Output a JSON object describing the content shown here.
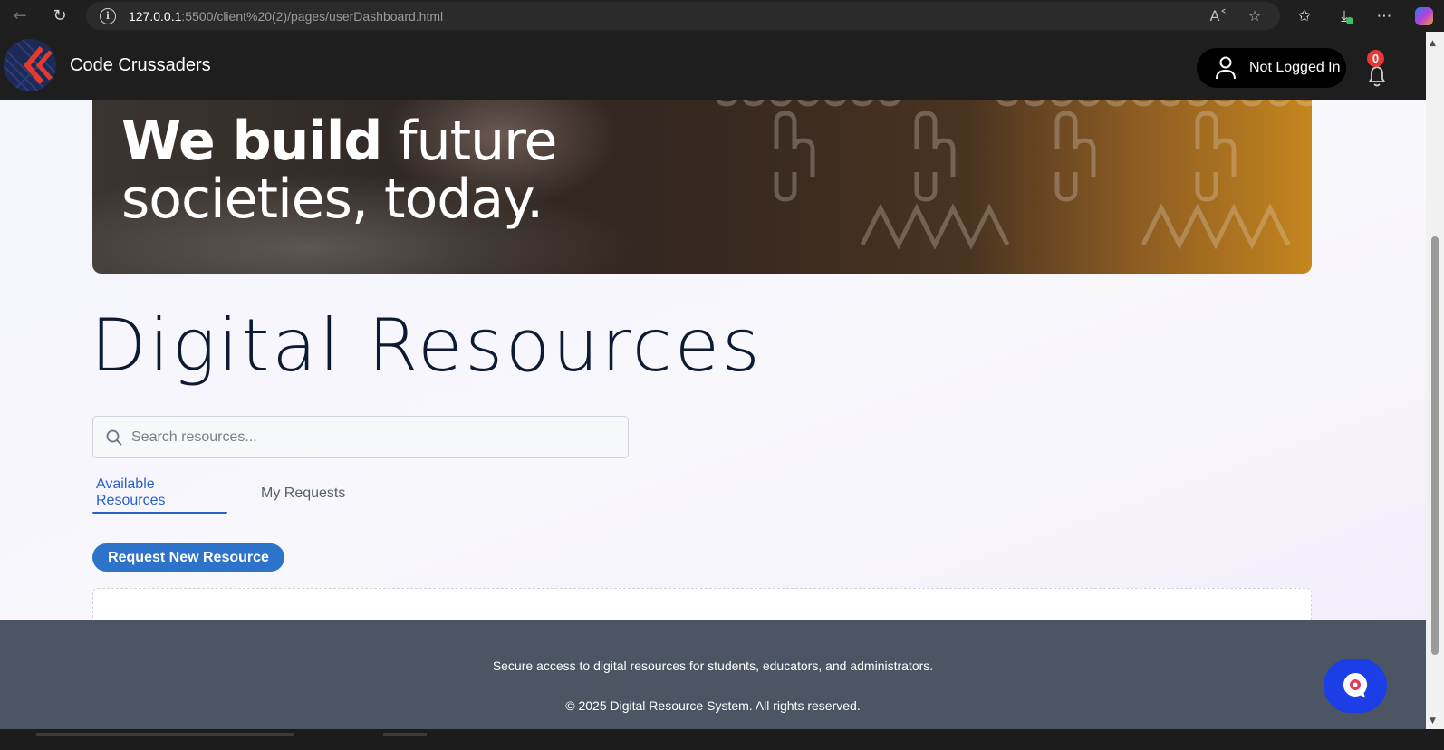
{
  "browser": {
    "url_host": "127.0.0.1",
    "url_rest": ":5500/client%20(2)/pages/userDashboard.html"
  },
  "header": {
    "brand": "Code Crussaders",
    "login_status": "Not Logged In",
    "notification_count": "0"
  },
  "hero": {
    "line1_bold": "We build",
    "line1_rest": " future",
    "line2": "societies, today."
  },
  "main": {
    "title": "Digital Resources",
    "search_placeholder": "Search resources...",
    "tabs": [
      {
        "label": "Available Resources",
        "active": true
      },
      {
        "label": "My Requests",
        "active": false
      }
    ],
    "request_button": "Request New Resource"
  },
  "footer": {
    "tagline": "Secure access to digital resources for students, educators, and administrators.",
    "copyright": "© 2025 Digital Resource System. All rights reserved."
  },
  "colors": {
    "accent": "#2a61c6",
    "button": "#2d73c9",
    "footer_bg": "#4b5563",
    "header_bg": "#1e1e1e",
    "badge": "#e53935",
    "chat_bg": "#1c3ee6"
  }
}
